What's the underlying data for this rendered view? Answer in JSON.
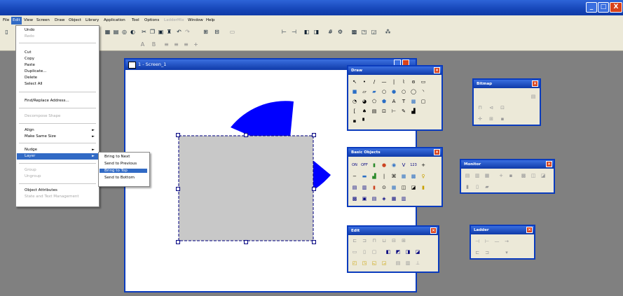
{
  "window_controls": {
    "minimize": "_",
    "maximize": "□",
    "close": "X"
  },
  "menubar": {
    "items": [
      "File",
      "Edit",
      "View",
      "Screen",
      "Draw",
      "Object",
      "Library",
      "Application",
      "Tool",
      "Options",
      "LadderMix",
      "Window",
      "Help"
    ]
  },
  "edit_menu": {
    "items": [
      {
        "label": "Undo",
        "enabled": true
      },
      {
        "label": "Redo",
        "enabled": false
      },
      {
        "label": "Cut",
        "enabled": true
      },
      {
        "label": "Copy",
        "enabled": true
      },
      {
        "label": "Paste",
        "enabled": true
      },
      {
        "label": "Duplicate...",
        "enabled": true
      },
      {
        "label": "Delete",
        "enabled": true
      },
      {
        "label": "Select All",
        "enabled": true
      },
      {
        "label": "Find/Replace Address...",
        "enabled": true
      },
      {
        "label": "Decompose Shape",
        "enabled": false
      },
      {
        "label": "Align",
        "enabled": true
      },
      {
        "label": "Make Same Size",
        "enabled": true
      },
      {
        "label": "Nudge",
        "enabled": true
      },
      {
        "label": "Layer",
        "enabled": true
      },
      {
        "label": "Group",
        "enabled": false
      },
      {
        "label": "Ungroup",
        "enabled": false
      },
      {
        "label": "Object Attributes",
        "enabled": true
      },
      {
        "label": "State and Text Management",
        "enabled": false
      }
    ]
  },
  "layer_submenu": {
    "items": [
      "Bring to Next",
      "Send to Previous",
      "Bring to Top",
      "Send to Bottom"
    ],
    "selected": "Bring to Top"
  },
  "document": {
    "title": "1 - Screen_1"
  },
  "palettes": {
    "draw": {
      "title": "Draw"
    },
    "bitmap": {
      "title": "Bitmap"
    },
    "basic_objects": {
      "title": "Basic Objects",
      "row1": [
        "ON",
        "OFF"
      ],
      "v_label": "V",
      "num_label": "123"
    },
    "monitor": {
      "title": "Monitor"
    },
    "edit": {
      "title": "Edit"
    },
    "ladder": {
      "title": "Ladder"
    }
  },
  "colors": {
    "titlebar": "#1646b8",
    "menu_highlight": "#316ac5",
    "workspace": "#808080",
    "pie_fill": "#0000ff",
    "rect_fill": "#c8c8c8",
    "palette_close": "#d9421b"
  },
  "icons": {
    "toolbar": [
      "new-icon",
      "open-icon",
      "save-icon",
      "grid-icon",
      "zoom-icon",
      "cut-icon",
      "copy-icon",
      "paste-icon",
      "find-icon",
      "undo-icon",
      "redo-icon"
    ]
  }
}
